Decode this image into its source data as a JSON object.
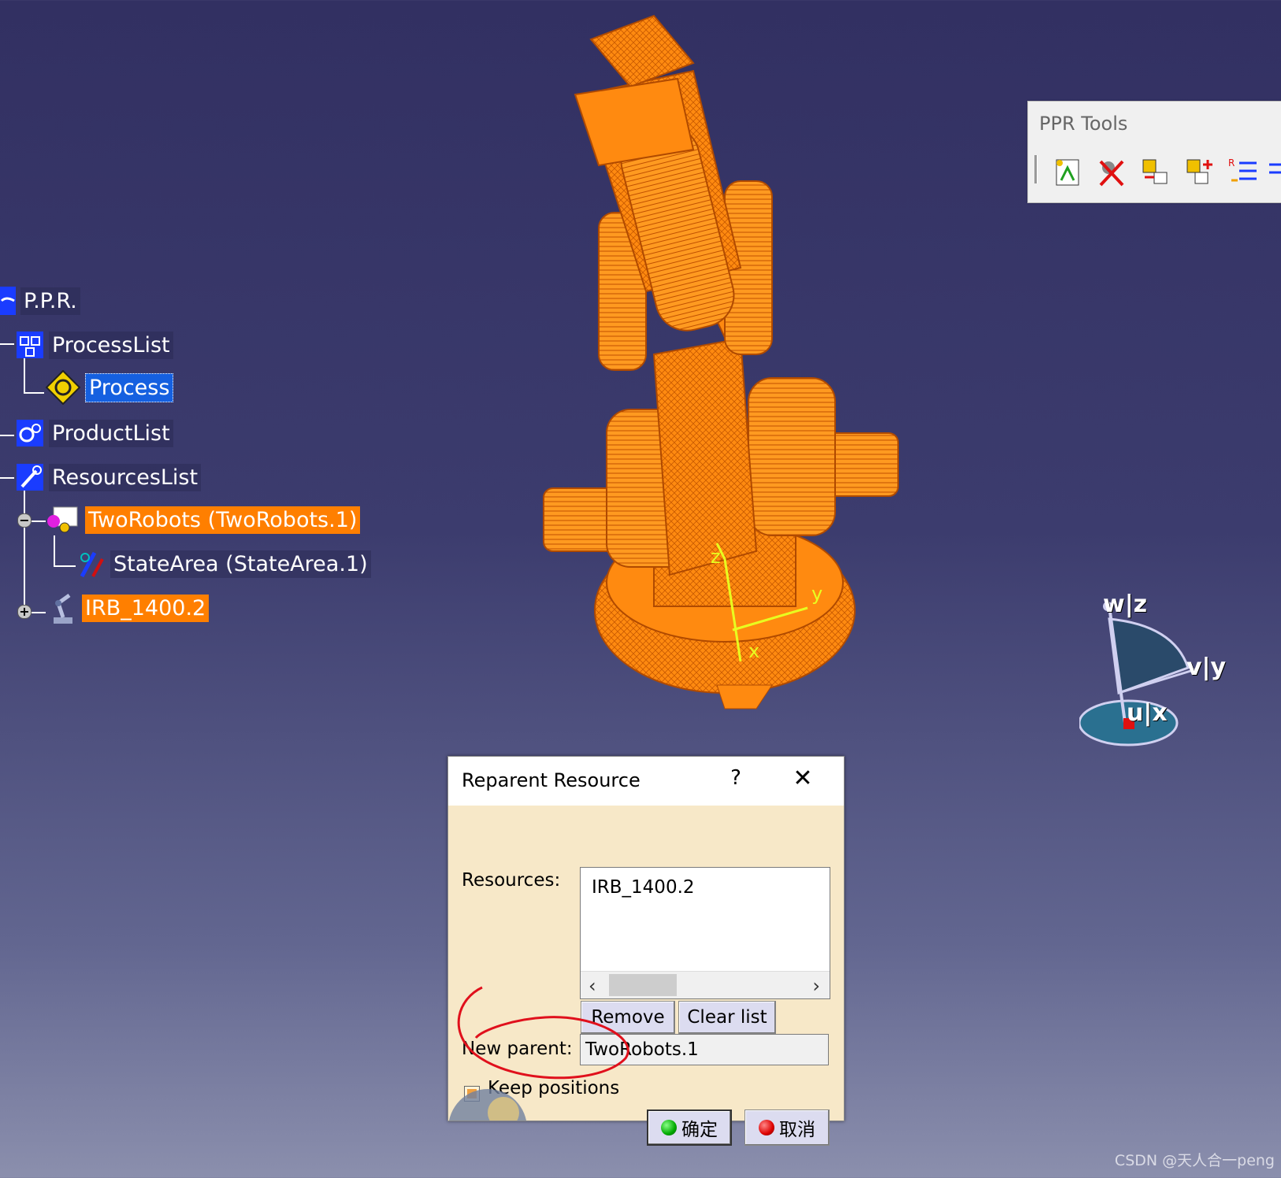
{
  "tree": {
    "root_label": "P.P.R.",
    "process_list_label": "ProcessList",
    "process_label": "Process",
    "product_list_label": "ProductList",
    "resources_list_label": "ResourcesList",
    "tworobots_label": "TwoRobots (TwoRobots.1)",
    "statearea_label": "StateArea (StateArea.1)",
    "irb_label": "IRB_1400.2"
  },
  "toolbar": {
    "title": "PPR Tools"
  },
  "compass": {
    "w_label": "w|z",
    "v_label": "v|y",
    "u_label": "u|x"
  },
  "robot_axes": {
    "z": "z",
    "y": "y",
    "x": "x"
  },
  "dialog": {
    "title": "Reparent Resource",
    "help": "?",
    "resources_label": "Resources:",
    "resources_items": [
      "IRB_1400.2"
    ],
    "remove_label": "Remove",
    "clear_label": "Clear list",
    "new_parent_label": "New parent:",
    "new_parent_value": "TwoRobots.1",
    "keep_positions_label": "Keep positions",
    "keep_positions_checked": true,
    "ok_label": "确定",
    "cancel_label": "取消"
  },
  "watermark": "CSDN @天人合一peng",
  "colors": {
    "selection_orange": "#ff7f00",
    "selection_blue": "#1560e0",
    "robot_orange": "#ff8a10",
    "annotation_red": "#e0101c"
  }
}
